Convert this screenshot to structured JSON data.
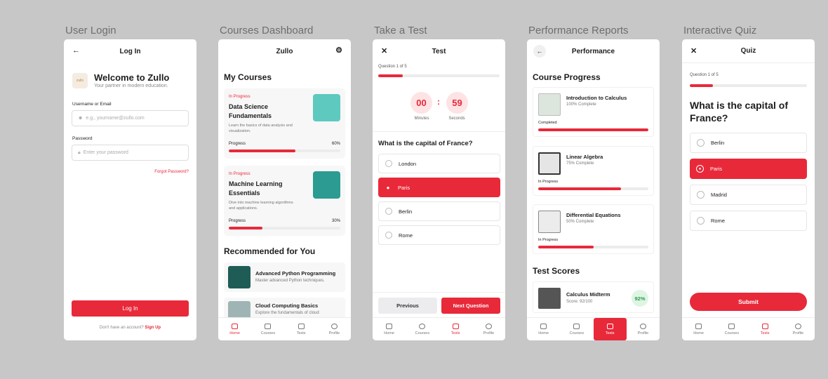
{
  "captions": [
    "User Login",
    "Courses Dashboard",
    "Take a Test",
    "Performance Reports",
    "Interactive Quiz"
  ],
  "login": {
    "title": "Log In",
    "logo_text": "zullo",
    "welcome": "Welcome to Zullo",
    "tagline": "Your partner in modern education.",
    "username_label": "Username or Email",
    "username_placeholder": "e.g., yourname@zullo.com",
    "password_label": "Password",
    "password_placeholder": "Enter your password",
    "forgot": "Forgot Password?",
    "login_button": "Log In",
    "no_account": "Don't have an account?",
    "signup": "Sign Up"
  },
  "dashboard": {
    "title": "Zullo",
    "my_courses": "My Courses",
    "courses": [
      {
        "status": "In Progress",
        "title": "Data Science Fundamentals",
        "desc": "Learn the basics of data analysis and visualization.",
        "progress_label": "Progress",
        "progress_text": "60%",
        "progress": 0.6,
        "thumb": "#5ec9bf"
      },
      {
        "status": "In Progress",
        "title": "Machine Learning Essentials",
        "desc": "Dive into machine learning algorithms and applications.",
        "progress_label": "Progress",
        "progress_text": "30%",
        "progress": 0.3,
        "thumb": "#2c9b92"
      }
    ],
    "recommended": "Recommended for You",
    "recs": [
      {
        "title": "Advanced Python Programming",
        "desc": "Master advanced Python techniques.",
        "thumb": "#1f5c56"
      },
      {
        "title": "Cloud Computing Basics",
        "desc": "Explore the fundamentals of cloud",
        "thumb": "#9fb5b5"
      }
    ],
    "nav": [
      "Home",
      "Courses",
      "Tests",
      "Profile"
    ]
  },
  "test": {
    "title": "Test",
    "question_counter": "Question 1 of 5",
    "progress": 0.2,
    "minutes": "00",
    "seconds": "59",
    "minutes_label": "Minutes",
    "seconds_label": "Seconds",
    "question": "What is the capital of France?",
    "options": [
      "London",
      "Paris",
      "Berlin",
      "Rome"
    ],
    "selected": 1,
    "previous": "Previous",
    "next": "Next Question",
    "nav": [
      "Home",
      "Courses",
      "Tests",
      "Profile"
    ]
  },
  "performance": {
    "title": "Performance",
    "course_progress": "Course Progress",
    "courses": [
      {
        "title": "Introduction to Calculus",
        "sub": "100% Complete",
        "status": "Completed",
        "progress": 1.0
      },
      {
        "title": "Linear Algebra",
        "sub": "75% Complete",
        "status": "In Progress",
        "progress": 0.75
      },
      {
        "title": "Differential Equations",
        "sub": "50% Complete",
        "status": "In Progress",
        "progress": 0.5
      }
    ],
    "test_scores": "Test Scores",
    "score": {
      "title": "Calculus Midterm",
      "sub": "Score: 92/100",
      "badge": "92%"
    },
    "nav": [
      "Home",
      "Courses",
      "Tests",
      "Profile"
    ]
  },
  "quiz": {
    "title": "Quiz",
    "question_counter": "Question 1 of 5",
    "progress": 0.2,
    "question": "What is the capital of France?",
    "options": [
      "Berlin",
      "Paris",
      "Madrid",
      "Rome"
    ],
    "selected": 1,
    "submit": "Submit",
    "nav": [
      "Home",
      "Courses",
      "Tests",
      "Profile"
    ]
  },
  "colors": {
    "accent": "#e8293a",
    "background": "#c7c7c7"
  }
}
